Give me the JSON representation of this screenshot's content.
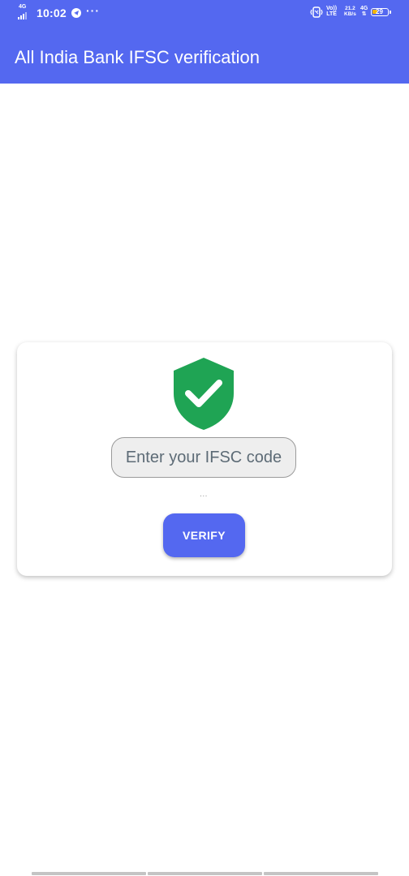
{
  "status_bar": {
    "network_tag": "4G",
    "time": "10:02",
    "more": "···",
    "volte_top": "Vo))",
    "volte_bottom": "LTE",
    "speed_top": "21.2",
    "speed_bottom": "KB/s",
    "net_type": "4G",
    "battery": "29"
  },
  "app_bar": {
    "title": "All India Bank IFSC verification"
  },
  "card": {
    "icon": "shield-check-icon",
    "input_placeholder": "Enter your IFSC code",
    "input_value": "",
    "result_text": "...",
    "verify_label": "VERIFY"
  },
  "colors": {
    "accent": "#5468f0",
    "shield": "#1fa454",
    "battery": "#f4b400"
  }
}
